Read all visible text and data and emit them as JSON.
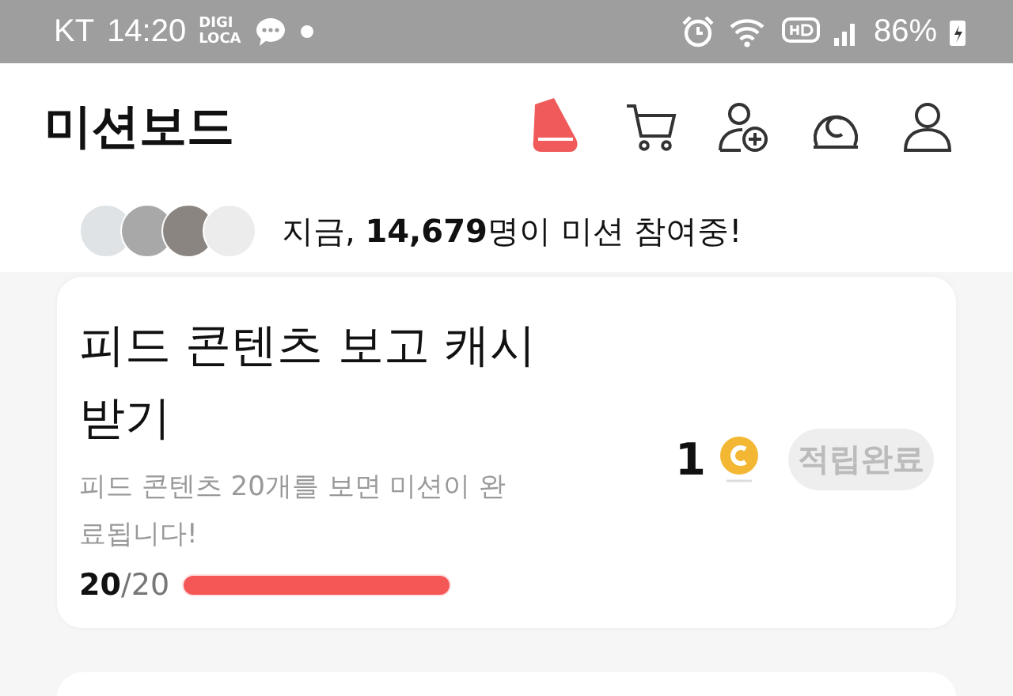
{
  "status_bar": {
    "carrier": "KT",
    "time": "14:20",
    "app_badge": "DIGI LOCA",
    "battery": "86%"
  },
  "header": {
    "title": "미션보드"
  },
  "participants": {
    "text": "지금, **14,679**명이 미션 참여중!"
  },
  "missions": [
    {
      "title": "피드 콘텐츠 보고 캐시 받기",
      "description": "피드 콘텐츠 20개를 보면 미션이 완료됩니다!",
      "done": "20",
      "total": "/20",
      "level": 1,
      "reward": "1",
      "button": "적립완료",
      "disabled": true
    }
  ]
}
